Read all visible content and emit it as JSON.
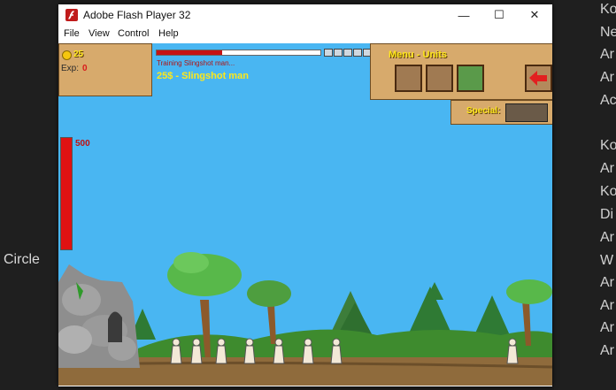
{
  "window": {
    "title": "Adobe Flash Player 32"
  },
  "window_controls": {
    "minimize": "—",
    "maximize": "☐",
    "close": "✕"
  },
  "menu": [
    "File",
    "View",
    "Control",
    "Help"
  ],
  "hud": {
    "gold": "25",
    "exp_label": "Exp:",
    "exp_value": "0",
    "training_text": "Training Slingshot man...",
    "training_progress": 0.4,
    "unit_info": "25$ - Slingshot man",
    "menu_title": "Menu - Units",
    "special_label": "Special:",
    "base_health": "500",
    "base_health_fraction": 1.0
  },
  "background_right_text": [
    "Ko",
    "Ne",
    "Ar",
    "Ar",
    "Ac",
    "Ko",
    "Ar",
    "Ko",
    "Di",
    "Ar",
    "W",
    "Ar",
    "Ar",
    "Ar",
    "Ar"
  ],
  "background_left_text": "Circle",
  "colors": {
    "sky": "#49b6f2",
    "panel": "#d7aa6c",
    "hud_yellow": "#ffe81a",
    "health": "#e01212",
    "ground": "#8f6b3c"
  }
}
